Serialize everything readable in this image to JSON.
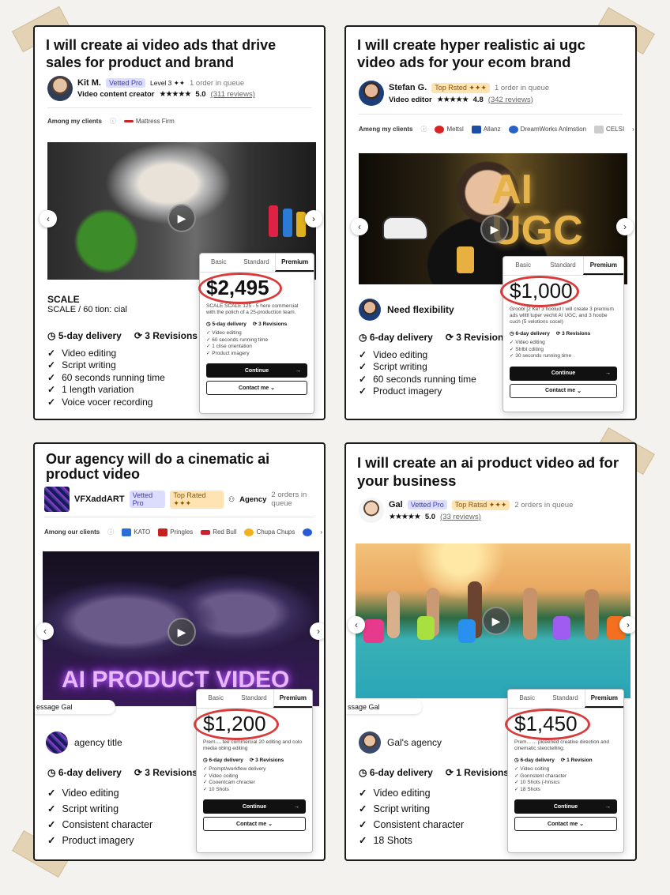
{
  "cards": [
    {
      "title": "I will create ai video ads that drive sales for product and brand",
      "seller_name": "Kit M.",
      "badge_vetted": "Vetted Pro",
      "level": "Level 3 ✦✦",
      "queue": "1 order in queue",
      "role": "Video content creator",
      "rating": "5.0",
      "reviews": "(311 reviews)",
      "clients_label": "Among my clients",
      "clients": [
        "Mattress Firm"
      ],
      "caption_title": "SCALE",
      "caption_sub": "SCALE / 60 tion: cial",
      "delivery": "5-day delivery",
      "revisions": "3 Revisions",
      "features": [
        "Video editing",
        "Script writing",
        "60 seconds running time",
        "1 length variation",
        "Voice vocer recording"
      ],
      "pkg": {
        "tabs": [
          "Basic",
          "Standard",
          "Premium"
        ],
        "price": "$2,495",
        "desc": "SCALE SCALE 125 - 5 here commercial with the polich of a 25-production team.",
        "delivery": "5-day delivery",
        "revisions": "3 Revisions",
        "items": [
          "Video editing",
          "60 seconds running time",
          "1 clise orientation",
          "Product imagery"
        ],
        "continue": "Continue",
        "contact": "Contact me"
      }
    },
    {
      "title": "I will create hyper realistic ai ugc video ads for your ecom brand",
      "seller_name": "Stefan G.",
      "badge_top": "Top Rsted ✦✦✦",
      "queue": "1 order in queue",
      "role": "Video editor",
      "rating": "4.8",
      "reviews": "(342 reviews)",
      "clients_label": "Ameng my clients",
      "clients": [
        "Mettsl",
        "Allanz",
        "DreamWorks Anlmstion",
        "CELSI"
      ],
      "media_text": "AI UGC",
      "agency_name": "Need flexibility",
      "delivery": "6-day delivery",
      "revisions": "3 Revisions",
      "features": [
        "Video editing",
        "Script writing",
        "60 seconds running time",
        "Product imagery"
      ],
      "pkg": {
        "tabs": [
          "Basic",
          "Standard",
          "Premium"
        ],
        "price": "$1,000",
        "desc": "Groobl [2 Ke! 3 hoolud I will create 3 premium ads wlltll tuper vechit AI UGC, and 3 hoobe cuch (5 velotions cocel)",
        "delivery": "6-day delivery",
        "revisions": "3 Revisions",
        "items": [
          "Video editing",
          "Strlbt cditing",
          "30 seconds running time"
        ],
        "continue": "Continue",
        "contact": "Contact me"
      }
    },
    {
      "title": "Our agency will do a cinematic ai product video",
      "seller_name": "VFXaddART",
      "badge_vetted": "Vetted Pro",
      "badge_top": "Top Rated ✦✦✦",
      "agency_tag": "Agency",
      "queue": "2 orders in queue",
      "clients_label": "Among our clients",
      "clients": [
        "KATO",
        "Pringles",
        "Red Bull",
        "Chupa Chups"
      ],
      "media_text": "AI PRODUCT VIDEO",
      "message": "essage Gal",
      "agency_name": "agency title",
      "delivery": "6-day delivery",
      "revisions": "3 Revisions",
      "features": [
        "Video editing",
        "Script writing",
        "Consistent character",
        "Product imagery"
      ],
      "pkg": {
        "tabs": [
          "Basic",
          "Standard",
          "Premium"
        ],
        "price": "$1,200",
        "desc": "Prem..., tee commercial 20 editing and colo media oblng editing",
        "delivery": "6-day delivery",
        "revisions": "3 Revisions",
        "items": [
          "Prompt/workflew delivery",
          "Video coiting",
          "Cooentcam chracter",
          "10 Shots"
        ],
        "continue": "Continue",
        "contact": "Contact me"
      }
    },
    {
      "title": "I will create an ai product video ad for your business",
      "seller_name": "Gal",
      "badge_vetted": "Vetted Pro",
      "badge_top": "Top Ratsd ✦✦✦",
      "queue": "2 orders in queue",
      "rating": "5.0",
      "reviews": "(33 reviews)",
      "message": "ssage Gal",
      "agency_name": "Gal's agency",
      "delivery": "6-day delivery",
      "revisions": "1 Revisions",
      "features": [
        "Video editing",
        "Script writing",
        "Consistent character",
        "18 Shots"
      ],
      "pkg": {
        "tabs": [
          "Basic",
          "Standard",
          "Premium"
        ],
        "price": "$1,450",
        "desc": "Prem... ... piceened creative direction and cinematic steoctelling.",
        "delivery": "6-day delivery",
        "revisions": "1 Revision",
        "items": [
          "Video coiting",
          "Gonnstent character",
          "10 Shots (-hnsics",
          "18 Shots"
        ],
        "continue": "Continue",
        "contact": "Contact me"
      }
    }
  ]
}
